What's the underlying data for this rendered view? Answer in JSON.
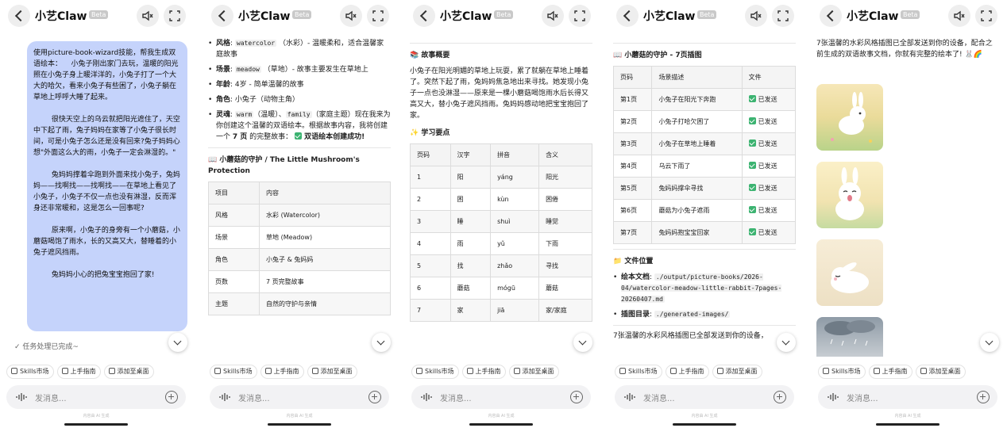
{
  "app": {
    "title": "小艺Claw",
    "beta": "Beta",
    "task_done": "任务处理已完成~",
    "input_placeholder": "发消息...",
    "footer_note": "内容由 AI 生成",
    "chips": [
      "Skills市场",
      "上手指南",
      "添加至桌面"
    ]
  },
  "panel1": {
    "message": "使用picture-book-wizard技能，帮我生成双语绘本：    小兔子刚出家门去玩，温暖的阳光照在小兔子身上暖洋洋的，小兔子打了一个大大的哈欠，看来小兔子有些困了，小兔子躺在草地上呼呼大睡了起来。\n\n        很快天空上的乌云就把阳光遮住了，天空中下起了雨，兔子妈妈在家等了小兔子很长时间，可是小兔子怎么还是没有回来?兔子妈妈心想\"外面这么大的雨，小兔子一定会淋湿的。\"\n\n        兔妈妈撑着伞跑到外面来找小兔子，兔妈妈——找啊找——找啊找——在草地上看见了小兔子，小兔子不仅一点也没有淋湿，反而浑身还非常暖和，这是怎么一回事呢?\n\n        原来啊，小兔子的身旁有一个小蘑菇，小蘑菇喝饱了雨水，长的又高又大，替睡着的小兔子遮风挡雨。\n\n        兔妈妈小心的把兔宝宝抱回了家!"
  },
  "panel2": {
    "items": [
      {
        "label": "风格",
        "code": "watercolor",
        "text": "（水彩）- 温暖柔和，适合温馨家庭故事"
      },
      {
        "label": "场景",
        "code": "meadow",
        "text": "（草地）- 故事主要发生在草地上"
      },
      {
        "label": "年龄",
        "code": "",
        "text": "4岁 - 简单温馨的故事"
      },
      {
        "label": "角色",
        "code": "",
        "text": "小兔子（动物主角）"
      }
    ],
    "theme_label": "灵魂",
    "theme_code1": "warm",
    "theme_mid1": "（温暖）、",
    "theme_code2": "family",
    "theme_mid2": "（家庭主题）现在我来为你创建这个温馨的双语绘本。根据故事内容，我将创建一个",
    "theme_pages": "7 页",
    "theme_tail": "的完整故事：",
    "success": "双语绘本创建成功!",
    "heading": "📖 小蘑菇的守护 / The Little Mushroom's Protection",
    "table_header": [
      "项目",
      "内容"
    ],
    "table_rows": [
      [
        "风格",
        "水彩 (Watercolor)"
      ],
      [
        "场景",
        "草地 (Meadow)"
      ],
      [
        "角色",
        "小兔子 & 兔妈妈"
      ],
      [
        "页数",
        "7 页完整故事"
      ],
      [
        "主题",
        "自然的守护与亲情"
      ]
    ]
  },
  "panel3": {
    "summary_heading": "📚 故事概要",
    "summary": "小兔子在阳光明媚的草地上玩耍，累了就躺在草地上睡着了。突然下起了雨，兔妈妈焦急地出来寻找。她发现小兔子一点也没淋湿——原来是一棵小蘑菇喝饱雨水后长得又高又大，替小兔子遮风挡雨。兔妈妈感动地把宝宝抱回了家。",
    "learn_heading": "✨ 学习要点",
    "table_header": [
      "页码",
      "汉字",
      "拼音",
      "含义"
    ],
    "table_rows": [
      [
        "1",
        "阳",
        "yáng",
        "阳光"
      ],
      [
        "2",
        "困",
        "kùn",
        "困倦"
      ],
      [
        "3",
        "睡",
        "shuì",
        "睡觉"
      ],
      [
        "4",
        "雨",
        "yǔ",
        "下雨"
      ],
      [
        "5",
        "找",
        "zhǎo",
        "寻找"
      ],
      [
        "6",
        "蘑菇",
        "mógū",
        "蘑菇"
      ],
      [
        "7",
        "家",
        "jiā",
        "家/家庭"
      ]
    ]
  },
  "panel4": {
    "heading": "📖 小蘑菇的守护 - 7页插图",
    "table_header": [
      "页码",
      "场景描述",
      "文件"
    ],
    "table_rows": [
      [
        "第1页",
        "小兔子在阳光下奔跑",
        "已发送"
      ],
      [
        "第2页",
        "小兔子打哈欠困了",
        "已发送"
      ],
      [
        "第3页",
        "小兔子在草地上睡着",
        "已发送"
      ],
      [
        "第4页",
        "乌云下雨了",
        "已发送"
      ],
      [
        "第5页",
        "兔妈妈撑伞寻找",
        "已发送"
      ],
      [
        "第6页",
        "蘑菇为小兔子遮雨",
        "已发送"
      ],
      [
        "第7页",
        "兔妈妈抱宝宝回家",
        "已发送"
      ]
    ],
    "location_heading": "📁 文件位置",
    "doc_label": "绘本文档",
    "doc_path": "./output/picture-books/2026-04/watercolor-meadow-little-rabbit-7pages-20260407.md",
    "img_label": "插图目录",
    "img_path": "./generated-images/",
    "tail": "7张温馨的水彩风格插图已全部发送到你的设备，"
  },
  "panel5": {
    "text": "7张温馨的水彩风格插图已全部发送到你的设备，配合之前生成的双语故事文档，你就有完整的绘本了! 🐰🌈"
  },
  "colors": {
    "bubble": "#c5d3fb",
    "sent": "#3cb371"
  }
}
